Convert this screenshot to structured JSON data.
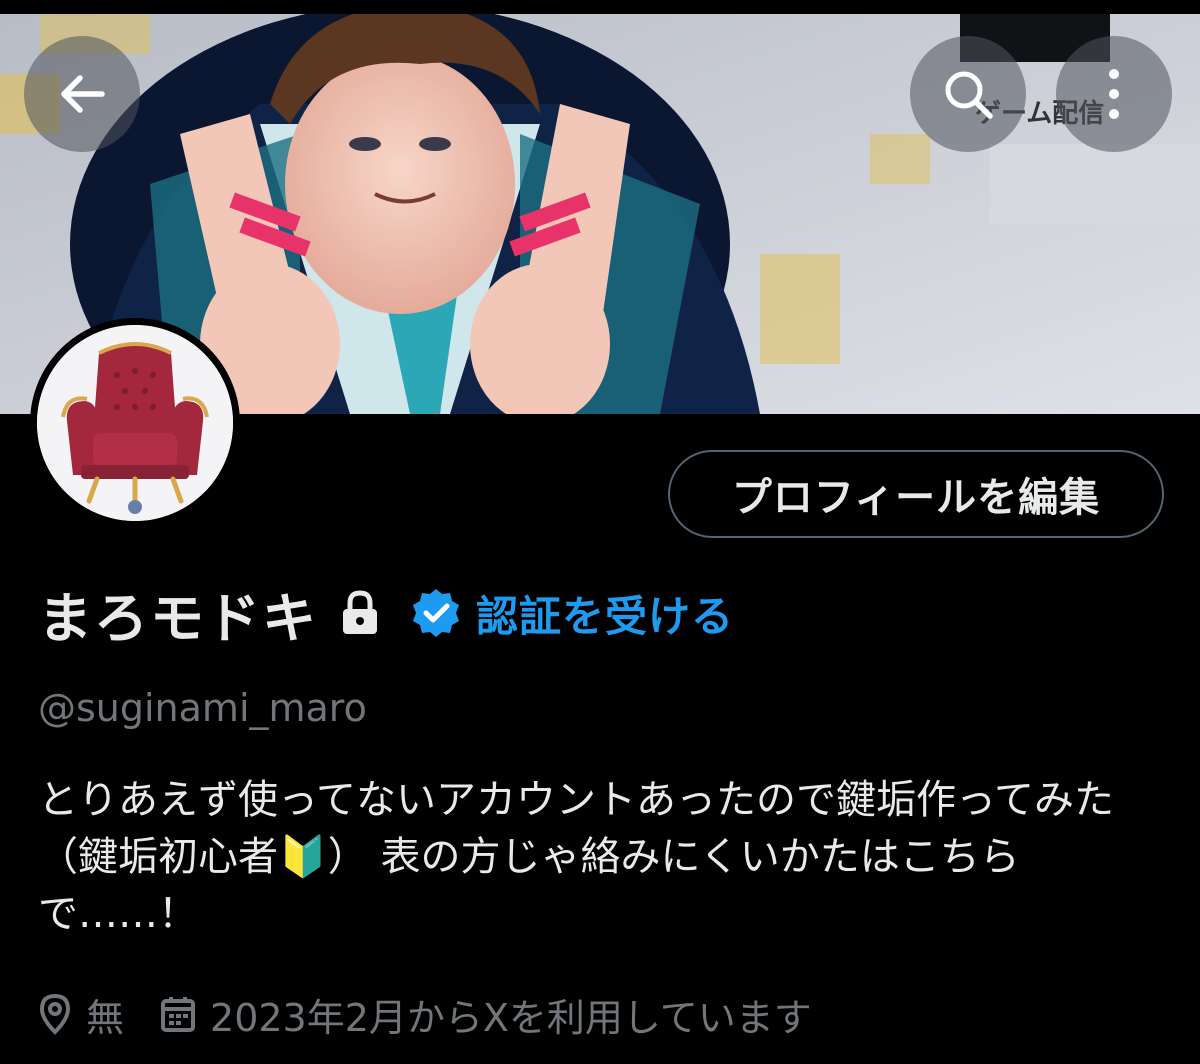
{
  "header": {
    "back_icon": "arrow-left-icon",
    "search_icon": "search-icon",
    "more_icon": "more-vertical-icon",
    "banner_overlay_text": "ゲーム配信"
  },
  "profile": {
    "edit_button_label": "プロフィールを編集",
    "display_name": "まろモドキ",
    "verify_link_label": "認証を受ける",
    "handle": "@suginami_maro",
    "bio": "とりあえず使ってないアカウントあったので鍵垢作ってみた（鍵垢初心者🔰） 表の方じゃ絡みにくいかたはこちらで……！",
    "location": "無",
    "joined": "2023年2月からXを利用しています"
  },
  "colors": {
    "accent": "#1d9bf0",
    "background": "#000000",
    "text_primary": "#e7e9ea",
    "text_secondary": "#71767b",
    "border": "#536471"
  }
}
